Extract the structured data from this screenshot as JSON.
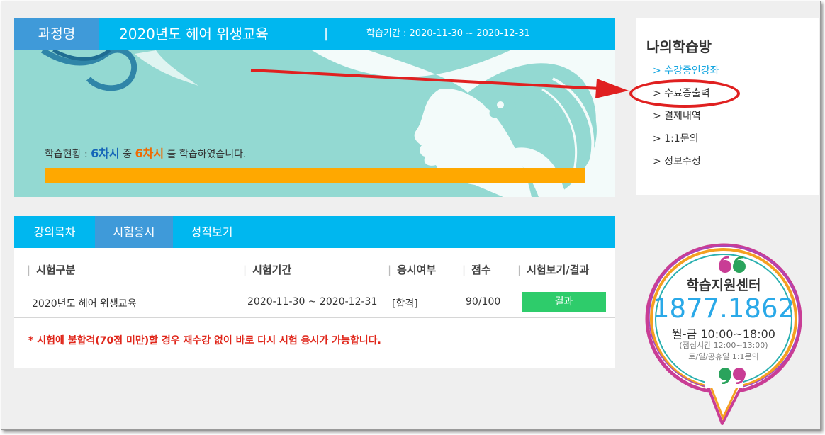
{
  "course": {
    "label": "과정명",
    "name": "2020년도 헤어 위생교육",
    "separator": "|",
    "period": "학습기간 : 2020-11-30 ~ 2020-12-31"
  },
  "progress": {
    "prefix": "학습현황 : ",
    "total": "6차시",
    "middle": " 중 ",
    "done": "6차시",
    "suffix": " 를 학습하였습니다.",
    "fraction": 1.0
  },
  "tabs": [
    {
      "label": "강의목차",
      "active": false
    },
    {
      "label": "시험응시",
      "active": true
    },
    {
      "label": "성적보기",
      "active": false
    }
  ],
  "exam_table": {
    "headers": [
      "시험구분",
      "시험기간",
      "응시여부",
      "점수",
      "시험보기/결과"
    ],
    "rows": [
      {
        "type": "2020년도 헤어 위생교육",
        "period": "2020-11-30 ~ 2020-12-31",
        "status": "[합격]",
        "score": "90/100",
        "action": "결과"
      }
    ],
    "notice": "* 시험에 불합격(70점 미만)할 경우 재수강 없이 바로 다시 시험 응시가 가능합니다."
  },
  "study_room": {
    "title": "나의학습방",
    "items": [
      {
        "label": "> 수강중인강좌",
        "active": true
      },
      {
        "label": "> 수료증출력",
        "active": false
      },
      {
        "label": "> 결제내역",
        "active": false
      },
      {
        "label": "> 1:1문의",
        "active": false
      },
      {
        "label": "> 정보수정",
        "active": false
      }
    ]
  },
  "support": {
    "title": "학습지원센터",
    "phone": "1877.1862",
    "hours": "월-금 10:00~18:00",
    "lunch": "(점심시간 12:00~13:00)",
    "off": "토/일/공휴일 1:1문의"
  },
  "colors": {
    "header_bg": "#00b7ef",
    "header_label_bg": "#3f9ad9",
    "banner_bg": "#93d9d2",
    "progress_fill": "#ffa800",
    "result_button": "#2ecc6b",
    "annotation_red": "#e02020"
  },
  "icons": [
    "arrow-annotation-icon",
    "quote-open-icon",
    "quote-close-icon"
  ]
}
